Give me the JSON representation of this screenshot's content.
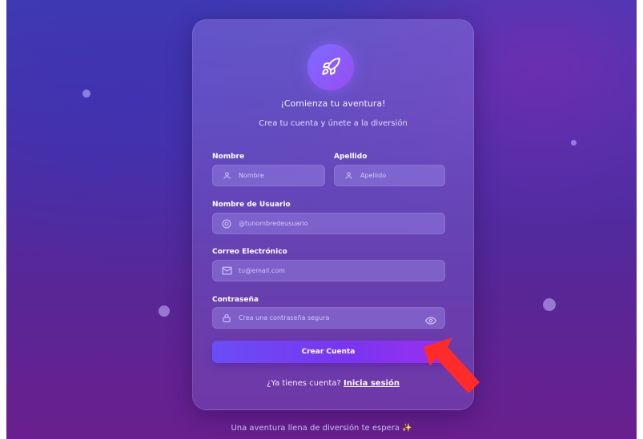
{
  "card": {
    "title": "¡Comienza tu aventura!",
    "subtitle": "Crea tu cuenta y únete a la diversión"
  },
  "form": {
    "first_name": {
      "label": "Nombre",
      "placeholder": "Nombre",
      "icon": "user-icon"
    },
    "last_name": {
      "label": "Apellido",
      "placeholder": "Apellido",
      "icon": "user-icon"
    },
    "username": {
      "label": "Nombre de Usuario",
      "placeholder": "@tunombredeusuario",
      "icon": "at-sign-icon"
    },
    "email": {
      "label": "Correo Electrónico",
      "placeholder": "tu@email.com",
      "icon": "mail-icon"
    },
    "password": {
      "label": "Contraseña",
      "placeholder": "Crea una contraseña segura",
      "icon": "lock-icon",
      "toggle_icon": "eye-icon"
    },
    "submit_label": "Crear Cuenta"
  },
  "footer": {
    "question": "¿Ya tienes cuenta?",
    "login_link": "Inicia sesión"
  },
  "tagline": "Una aventura llena de diversión te espera ✨",
  "colors": {
    "accent": "#7a35f0",
    "annotation_arrow": "#ff2a2a"
  }
}
